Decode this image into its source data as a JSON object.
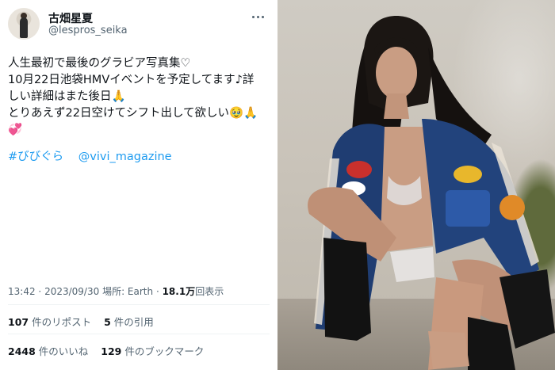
{
  "user": {
    "display_name": "古畑星夏",
    "handle": "@lespros_seika"
  },
  "tweet": {
    "lines": [
      "人生最初で最後のグラビア写真集♡",
      "10月22日池袋HMVイベントを予定してます♪詳",
      "しい詳細はまた後日🙏",
      "とりあえず22日空けてシフト出して欲しい🥹🙏",
      "💞"
    ],
    "hashtag": "#びびぐら",
    "mention": "@vivi_magazine"
  },
  "meta": {
    "time": "13:42",
    "date": "2023/09/30",
    "place": "場所: Earth",
    "views_count": "18.1万",
    "views_label": "回表示"
  },
  "stats": {
    "reposts_count": "107",
    "reposts_label": "件のリポスト",
    "quotes_count": "5",
    "quotes_label": "件の引用",
    "likes_count": "2448",
    "likes_label": "件のいいね",
    "bookmarks_count": "129",
    "bookmarks_label": "件のブックマーク"
  },
  "icons": {
    "more": "more-horizontal-icon"
  },
  "colors": {
    "link": "#1d9bf0",
    "secondary_text": "#536471",
    "primary_text": "#0f1419"
  }
}
